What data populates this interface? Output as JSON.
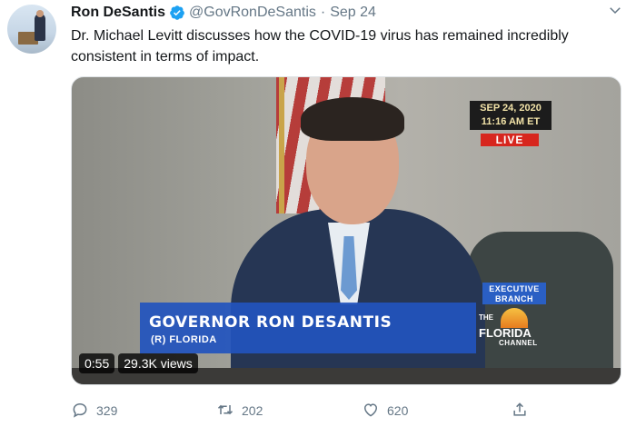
{
  "tweet": {
    "author_name": "Ron DeSantis",
    "handle": "@GovRonDeSantis",
    "separator": "·",
    "date": "Sep 24",
    "text": "Dr. Michael Levitt discusses how the COVID-19 virus has remained incredibly consistent in terms of impact."
  },
  "video": {
    "timestamp_date": "SEP 24, 2020",
    "timestamp_time": "11:16 AM ET",
    "live_label": "LIVE",
    "lower_third_title": "GOVERNOR RON DESANTIS",
    "lower_third_subtitle": "(R) FLORIDA",
    "network_tag": "EXECUTIVE BRANCH",
    "logo_the": "THE",
    "logo_florida": "FLORIDA",
    "logo_channel": "CHANNEL",
    "duration": "0:55",
    "views": "29.3K views"
  },
  "actions": {
    "replies": "329",
    "retweets": "202",
    "likes": "620"
  },
  "icons": {
    "verified": "verified-badge-icon",
    "more": "chevron-down-icon",
    "reply": "reply-icon",
    "retweet": "retweet-icon",
    "like": "heart-icon",
    "share": "share-icon"
  },
  "colors": {
    "verified_blue": "#1da1f2",
    "muted_text": "#657786",
    "live_red": "#d7261e",
    "lower_third_blue": "#2254be"
  }
}
